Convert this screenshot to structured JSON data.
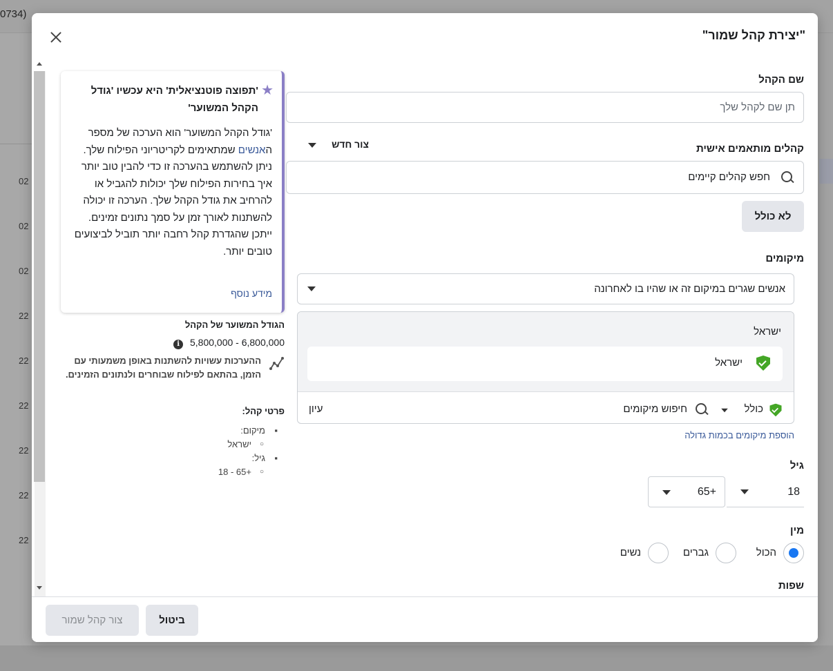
{
  "background": {
    "id_fragment": "0734)",
    "row_values": [
      "02",
      "02",
      "02",
      "22",
      "22",
      "22",
      "22",
      "22",
      "22"
    ]
  },
  "modal": {
    "title": "\"יצירת קהל שמור\"",
    "audience_name": {
      "label": "שם הקהל",
      "placeholder": "תן שם לקהל שלך"
    },
    "custom_audiences": {
      "label": "קהלים מותאמים אישית",
      "create_new": "צור חדש",
      "search_placeholder": "חפש קהלים קיימים",
      "exclude_button": "לא כולל"
    },
    "locations": {
      "label": "מיקומים",
      "dropdown_value": "אנשים שגרים במיקום זה או שהיו בו לאחרונה",
      "group_heading": "ישראל",
      "selected_location": "ישראל",
      "include_label": "כולל",
      "search_placeholder": "חיפוש מיקומים",
      "browse_label": "עיון",
      "bulk_add_link": "הוספת מיקומים בכמות גדולה"
    },
    "age": {
      "label": "גיל",
      "min": "18",
      "max": "65+"
    },
    "gender": {
      "label": "מין",
      "options": [
        "הכול",
        "גברים",
        "נשים"
      ],
      "selected": "הכול"
    },
    "languages": {
      "label": "שפות"
    },
    "tip": {
      "title": "'תפוצה פוטנציאלית' היא עכשיו 'גודל הקהל המשוער'",
      "body_before": "'גודל הקהל המשוער' הוא הערכה של מספר ה",
      "body_link": "אנשים",
      "body_after": " שמתאימים לקריטריוני הפילוח שלך. ניתן להשתמש בהערכה זו כדי להבין טוב יותר איך בחירות הפילוח שלך יכולות להגביל או להרחיב את גודל הקהל שלך. הערכה זו יכולה להשתנות לאורך זמן על סמך נתונים זמינים. ייתכן שהגדרת קהל רחבה יותר תוביל לביצועים טובים יותר.",
      "more_link": "מידע נוסף"
    },
    "audience_size": {
      "heading": "הגודל המשוער של הקהל",
      "range": "5,800,000 - 6,800,000",
      "note": "ההערכות עשויות להשתנות באופן משמעותי עם הזמן, בהתאם לפילוח שבוחרים ולנתונים הזמינים."
    },
    "audience_details": {
      "heading": "פרטי קהל:",
      "location_label": "מיקום:",
      "location_value": "ישראל",
      "age_label": "גיל:",
      "age_value": "18 - 65+"
    },
    "footer": {
      "cancel": "ביטול",
      "save": "צור קהל שמור"
    }
  }
}
